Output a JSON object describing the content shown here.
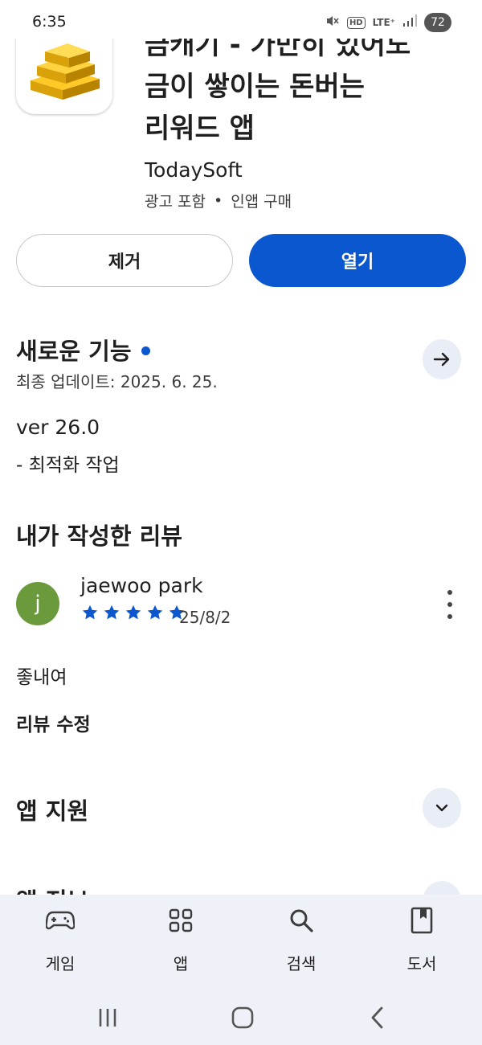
{
  "status_bar": {
    "time": "6:35",
    "network": "LTE⁺",
    "battery": "72"
  },
  "app": {
    "title_lines": [
      "금캐기 - 가만히 있어도",
      "금이 쌓이는 돈버는",
      "리워드 앱"
    ],
    "developer": "TodaySoft",
    "meta_ads": "광고 포함",
    "meta_separator": "•",
    "meta_iap": "인앱 구매"
  },
  "actions": {
    "remove_label": "제거",
    "open_label": "열기"
  },
  "whats_new": {
    "title": "새로운 기능",
    "last_updated": "최종 업데이트: 2025. 6. 25.",
    "version": "ver 26.0",
    "note": "- 최적화 작업"
  },
  "my_review": {
    "title": "내가 작성한 리뷰",
    "avatar_letter": "j",
    "reviewer": "jaewoo park",
    "rating": 5,
    "date": "25/8/2",
    "text": "좋내여",
    "edit_label": "리뷰 수정"
  },
  "app_support": {
    "title": "앱 지원"
  },
  "next_section": {
    "title": "앱 정보"
  },
  "bottom_nav": {
    "items": [
      {
        "label": "게임",
        "icon": "gamepad-icon"
      },
      {
        "label": "앱",
        "icon": "apps-grid-icon"
      },
      {
        "label": "검색",
        "icon": "search-icon"
      },
      {
        "label": "도서",
        "icon": "book-icon"
      }
    ]
  },
  "colors": {
    "accent": "#0b57d0",
    "avatar": "#6a9a3b",
    "nav_background": "#eef2f8",
    "circle_button": "#e8edf6"
  }
}
